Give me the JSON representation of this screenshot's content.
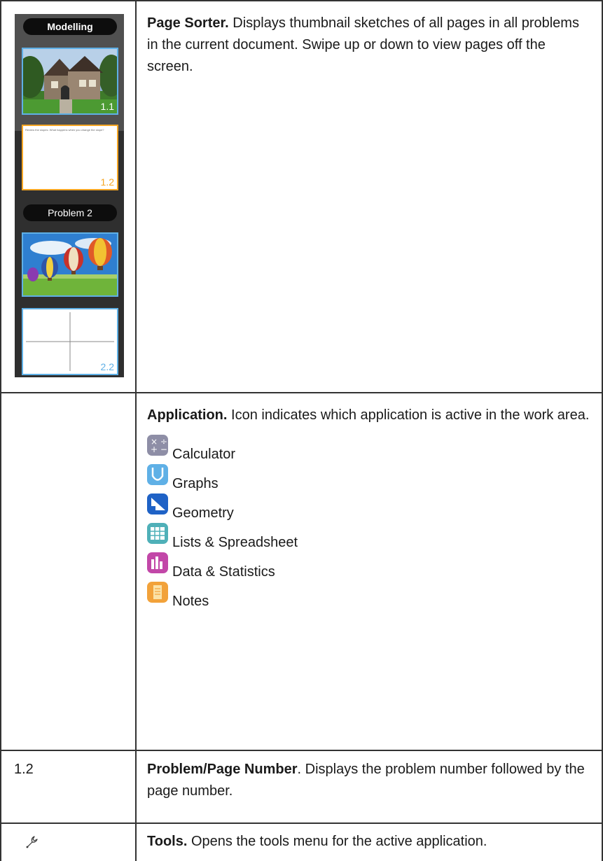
{
  "rows": {
    "page_sorter": {
      "title": "Page Sorter.",
      "text": " Displays thumbnail sketches of all pages in all problems in the current document. Swipe up or down to view pages off the screen.",
      "panel": {
        "problem1_label": "Modelling",
        "page_1_1_number": "1.1",
        "page_1_2_number": "1.2",
        "page_1_2_text": "Review the slopes. What happens when you change the slope?",
        "problem2_label": "Problem 2",
        "page_2_2_number": "2.2"
      }
    },
    "application": {
      "title": "Application.",
      "text": " Icon indicates which application is active in the work area.",
      "apps": [
        {
          "label": "Calculator",
          "icon": "calculator-icon",
          "color": "#8e8ea6"
        },
        {
          "label": "Graphs",
          "icon": "graphs-icon",
          "color": "#5fb0e6"
        },
        {
          "label": "Geometry",
          "icon": "geometry-icon",
          "color": "#1f62c6"
        },
        {
          "label": "Lists & Spreadsheet",
          "icon": "lists-spreadsheet-icon",
          "color": "#4fb0b8"
        },
        {
          "label": "Data & Statistics",
          "icon": "data-statistics-icon",
          "color": "#c247a8"
        },
        {
          "label": "Notes",
          "icon": "notes-icon",
          "color": "#f2a23a"
        }
      ]
    },
    "page_number": {
      "label": "1.2",
      "title": "Problem/Page Number",
      "text": ". Displays the problem number followed by the page number."
    },
    "tools": {
      "icon": "wrench-icon",
      "title": "Tools.",
      "text": " Opens the tools menu for the active application."
    }
  }
}
